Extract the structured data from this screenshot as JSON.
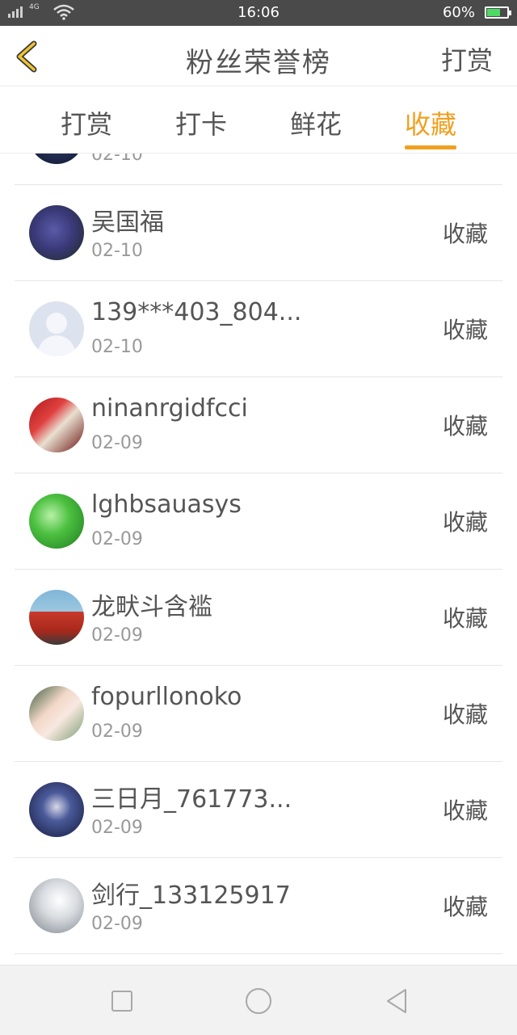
{
  "status_bar": {
    "time": "16:06",
    "battery_percent": "60%",
    "battery_level": 0.6,
    "network": "4G"
  },
  "header": {
    "title": "粉丝荣誉榜",
    "right_action": "打赏"
  },
  "tabs": [
    {
      "label": "打赏",
      "active": false
    },
    {
      "label": "打卡",
      "active": false
    },
    {
      "label": "鲜花",
      "active": false
    },
    {
      "label": "收藏",
      "active": true
    }
  ],
  "list": {
    "partial_row": {
      "date": "02-10"
    },
    "items": [
      {
        "name": "吴国福",
        "date": "02-10",
        "action": "收藏"
      },
      {
        "name": "139***403_804...",
        "date": "02-10",
        "action": "收藏"
      },
      {
        "name": "ninanrgidfcci",
        "date": "02-09",
        "action": "收藏"
      },
      {
        "name": "lghbsauasys",
        "date": "02-09",
        "action": "收藏"
      },
      {
        "name": "龙畎斗含褴",
        "date": "02-09",
        "action": "收藏"
      },
      {
        "name": "fopurllonoko",
        "date": "02-09",
        "action": "收藏"
      },
      {
        "name": "三日月_761773...",
        "date": "02-09",
        "action": "收藏"
      },
      {
        "name": "剑行_133125917",
        "date": "02-09",
        "action": "收藏"
      }
    ]
  },
  "colors": {
    "accent": "#f0a020",
    "status_bar": "#4a4a4a",
    "text": "#555555",
    "subtext": "#999999"
  }
}
